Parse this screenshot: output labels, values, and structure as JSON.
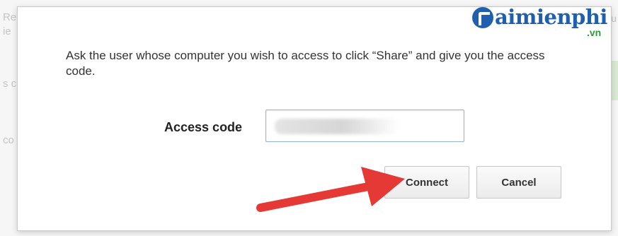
{
  "watermark": {
    "brand": "aimienphi",
    "domain": ".vn"
  },
  "dialog": {
    "instructions": "Ask the user whose computer you wish to access to click “Share” and give you the access code.",
    "access_code_label": "Access code",
    "access_code_value": "",
    "connect_label": "Connect",
    "cancel_label": "Cancel"
  },
  "colors": {
    "annotation_arrow": "#e53935",
    "logo_blue": "#1f5fae",
    "logo_green": "#2f9a3a",
    "input_border": "#8fb3e0"
  }
}
